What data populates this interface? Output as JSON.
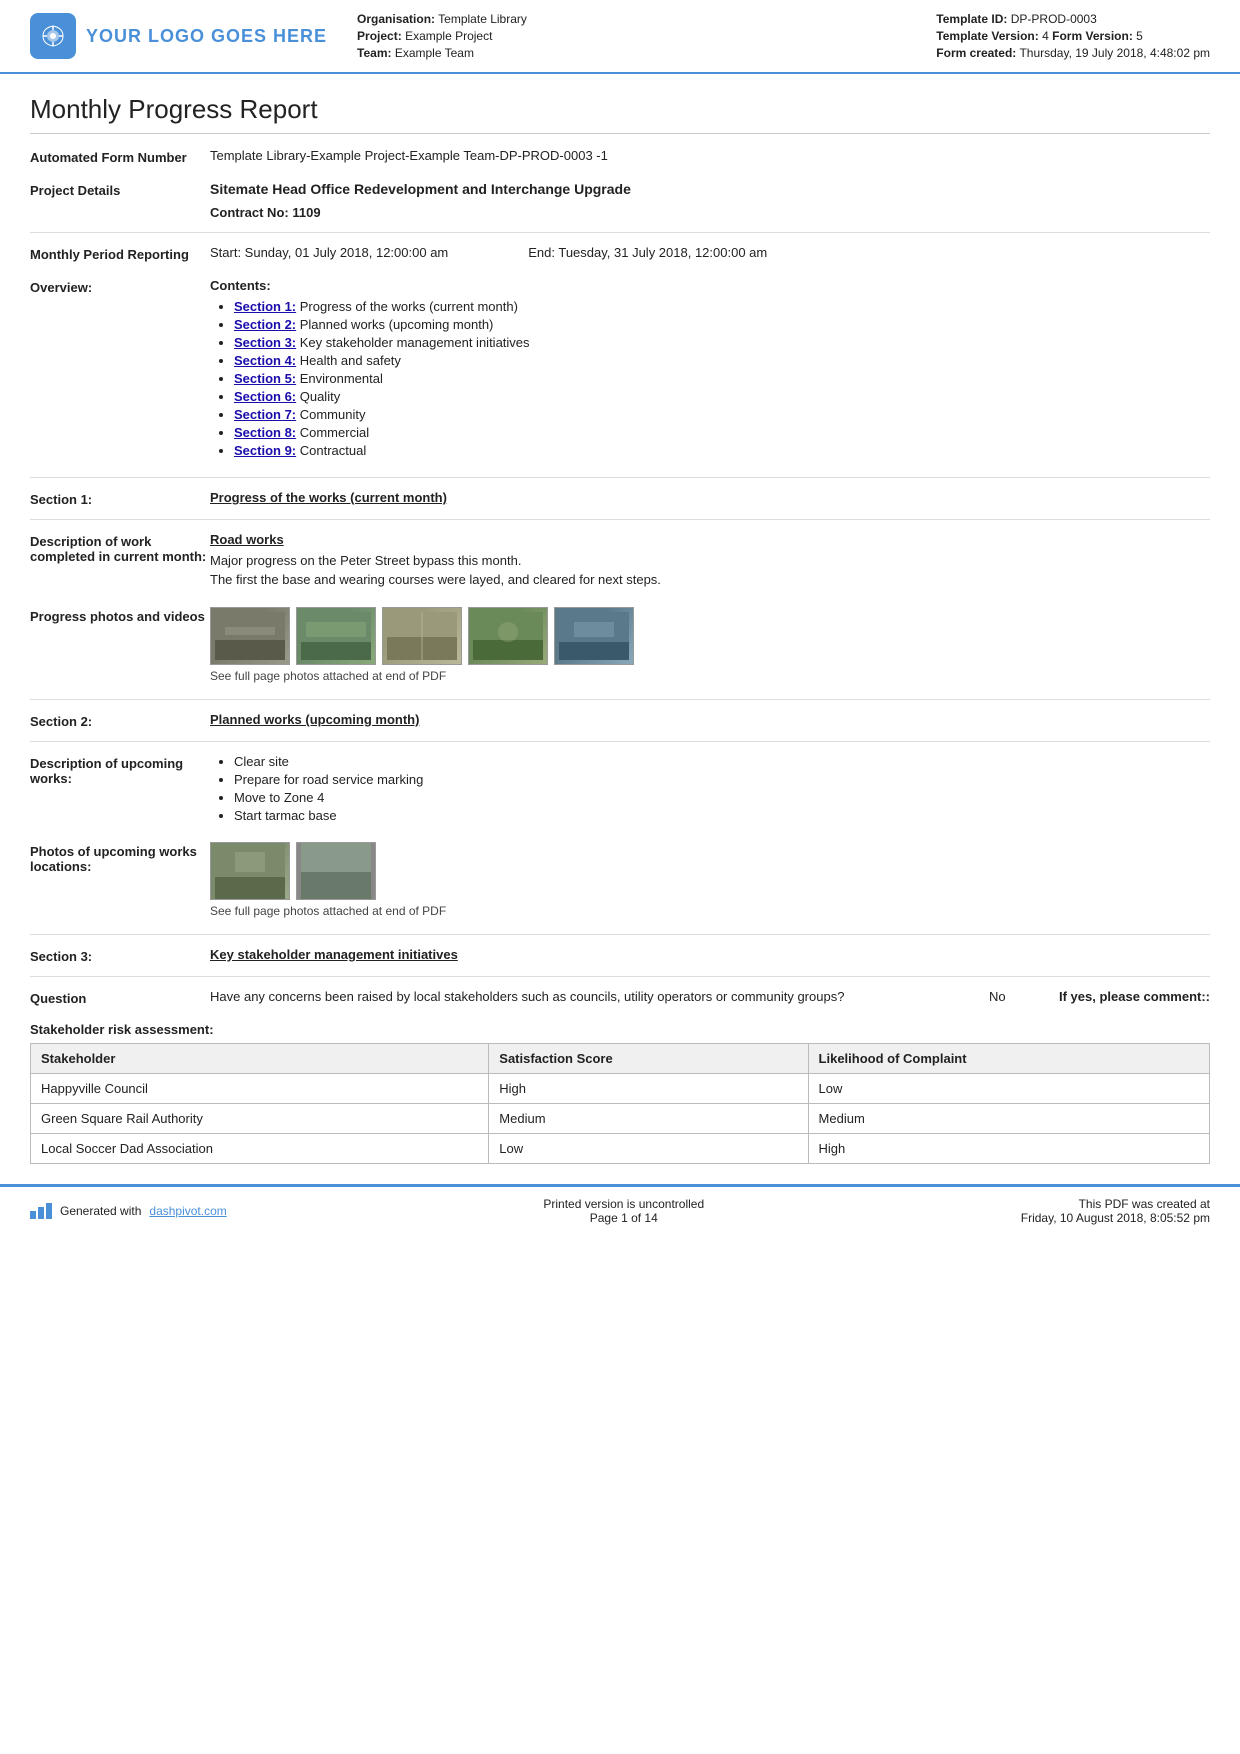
{
  "header": {
    "logo_text": "YOUR LOGO GOES HERE",
    "org_label": "Organisation:",
    "org_value": "Template Library",
    "project_label": "Project:",
    "project_value": "Example Project",
    "team_label": "Team:",
    "team_value": "Example Team",
    "template_id_label": "Template ID:",
    "template_id_value": "DP-PROD-0003",
    "template_version_label": "Template Version:",
    "template_version_value": "4",
    "form_version_label": "Form Version:",
    "form_version_value": "5",
    "form_created_label": "Form created:",
    "form_created_value": "Thursday, 19 July 2018, 4:48:02 pm"
  },
  "report": {
    "title": "Monthly Progress Report",
    "automated_form_number_label": "Automated Form Number",
    "automated_form_number_value": "Template Library-Example Project-Example Team-DP-PROD-0003   -1",
    "project_details_label": "Project Details",
    "project_details_value": "Sitemate Head Office Redevelopment and Interchange Upgrade",
    "contract_no_label": "Contract No:",
    "contract_no_value": "1109",
    "monthly_period_label": "Monthly Period Reporting",
    "period_start": "Start: Sunday, 01 July 2018, 12:00:00 am",
    "period_end": "End: Tuesday, 31 July 2018, 12:00:00 am",
    "overview_label": "Overview:",
    "contents_label": "Contents:",
    "contents_items": [
      {
        "link_text": "Section 1:",
        "desc": " Progress of the works (current month)"
      },
      {
        "link_text": "Section 2:",
        "desc": " Planned works (upcoming month)"
      },
      {
        "link_text": "Section 3:",
        "desc": " Key stakeholder management initiatives"
      },
      {
        "link_text": "Section 4:",
        "desc": " Health and safety"
      },
      {
        "link_text": "Section 5:",
        "desc": " Environmental"
      },
      {
        "link_text": "Section 6:",
        "desc": " Quality"
      },
      {
        "link_text": "Section 7:",
        "desc": " Community"
      },
      {
        "link_text": "Section 8:",
        "desc": " Commercial"
      },
      {
        "link_text": "Section 9:",
        "desc": " Contractual"
      }
    ],
    "section1_label": "Section 1:",
    "section1_heading": "Progress of the works (current month)",
    "desc_work_label": "Description of work completed in current month:",
    "road_works_heading": "Road works",
    "road_works_text1": "Major progress on the Peter Street bypass this month.",
    "road_works_text2": "The first the base and wearing courses were layed, and cleared for next steps.",
    "photos_label": "Progress photos and videos",
    "photos_caption": "See full page photos attached at end of PDF",
    "section2_label": "Section 2:",
    "section2_heading": "Planned works (upcoming month)",
    "upcoming_desc_label": "Description of upcoming works:",
    "upcoming_items": [
      "Clear site",
      "Prepare for road service marking",
      "Move to Zone 4",
      "Start tarmac base"
    ],
    "upcoming_photos_label": "Photos of upcoming works locations:",
    "upcoming_photos_caption": "See full page photos attached at end of PDF",
    "section3_label": "Section 3:",
    "section3_heading": "Key stakeholder management initiatives",
    "question_label": "Question",
    "question_text": "Have any concerns been raised by local stakeholders such as councils, utility operators or community groups?",
    "question_answer": "No",
    "question_comment": "If yes, please comment::",
    "stakeholder_table_title": "Stakeholder risk assessment:",
    "table_headers": [
      "Stakeholder",
      "Satisfaction Score",
      "Likelihood of Complaint"
    ],
    "table_rows": [
      [
        "Happyville Council",
        "High",
        "Low"
      ],
      [
        "Green Square Rail Authority",
        "Medium",
        "Medium"
      ],
      [
        "Local Soccer Dad Association",
        "Low",
        "High"
      ]
    ]
  },
  "footer": {
    "generated_text": "Generated with ",
    "link_text": "dashpivot.com",
    "center_line1": "Printed version is uncontrolled",
    "center_line2": "Page 1 of 14",
    "right_line1": "This PDF was created at",
    "right_line2": "Friday, 10 August 2018, 8:05:52 pm"
  }
}
